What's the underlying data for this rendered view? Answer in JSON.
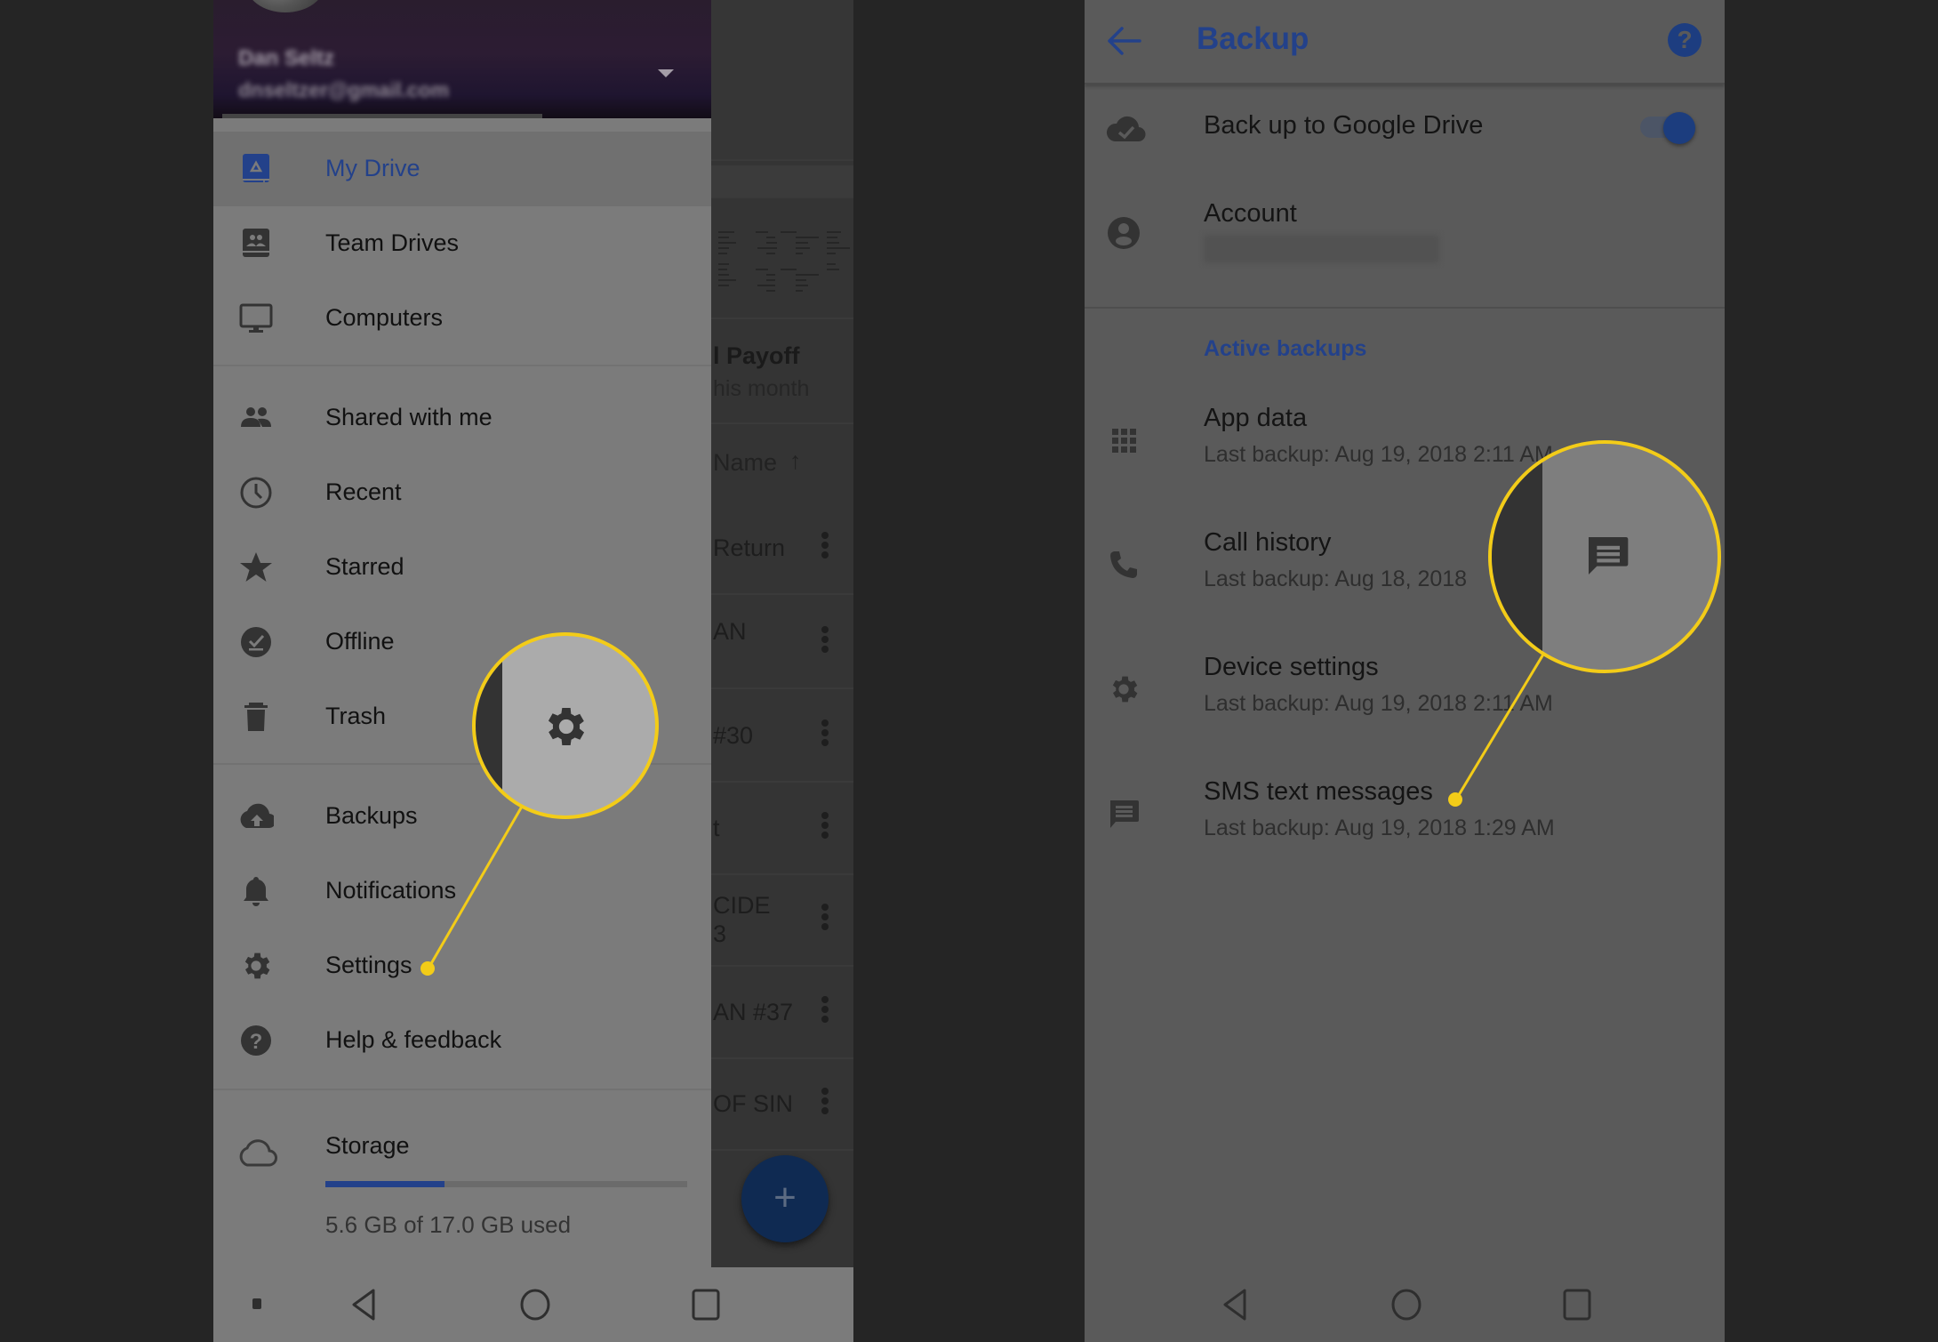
{
  "drive_drawer": {
    "account": {
      "name": "Dan Seltz",
      "email": "dnseltzer@gmail.com"
    },
    "items": [
      {
        "label": "My Drive",
        "icon": "drive-icon",
        "active": true
      },
      {
        "label": "Team Drives",
        "icon": "team-drives-icon"
      },
      {
        "label": "Computers",
        "icon": "computer-icon"
      },
      {
        "label": "Shared with me",
        "icon": "people-icon"
      },
      {
        "label": "Recent",
        "icon": "clock-icon"
      },
      {
        "label": "Starred",
        "icon": "star-icon"
      },
      {
        "label": "Offline",
        "icon": "offline-icon"
      },
      {
        "label": "Trash",
        "icon": "trash-icon"
      },
      {
        "label": "Backups",
        "icon": "cloud-upload-icon"
      },
      {
        "label": "Notifications",
        "icon": "bell-icon"
      },
      {
        "label": "Settings",
        "icon": "gear-icon"
      },
      {
        "label": "Help & feedback",
        "icon": "help-icon"
      }
    ],
    "storage": {
      "label": "Storage",
      "used_text": "5.6 GB of 17.0 GB used",
      "used_fraction": 0.329
    }
  },
  "background_list": {
    "quick_access_title": "l Payoff",
    "quick_access_subtitle": "his month",
    "sort_label": "Name",
    "sort_icon": "arrow-up-icon",
    "files": [
      "Return",
      "AN",
      "#30",
      "t",
      "CIDE\n3",
      "AN #37",
      "OF SIN"
    ],
    "fab_label": "+"
  },
  "backup_screen": {
    "title": "Backup",
    "back_icon": "arrow-back-icon",
    "help_icon": "help-icon",
    "backup_to_drive": {
      "label": "Back up to Google Drive",
      "enabled": true
    },
    "account": {
      "label": "Account",
      "value": ""
    },
    "section_header": "Active backups",
    "active_backups": [
      {
        "title": "App data",
        "subtitle": "Last backup: Aug 19, 2018 2:11 AM",
        "icon": "apps-grid-icon"
      },
      {
        "title": "Call history",
        "subtitle": "Last backup: Aug 18, 2018",
        "icon": "phone-icon"
      },
      {
        "title": "Device settings",
        "subtitle": "Last backup: Aug 19, 2018 2:11 AM",
        "icon": "gear-icon"
      },
      {
        "title": "SMS text messages",
        "subtitle": "Last backup: Aug 19, 2018 1:29 AM",
        "icon": "message-icon"
      }
    ]
  },
  "callouts": [
    {
      "target": "Settings",
      "icon": "gear-icon"
    },
    {
      "target": "SMS text messages",
      "icon": "message-icon"
    }
  ],
  "colors": {
    "accent_blue": "#23418a",
    "callout_yellow": "#f3cc18",
    "drawer_bg": "#7b7b7b",
    "backup_bg": "#5a5a5a"
  }
}
